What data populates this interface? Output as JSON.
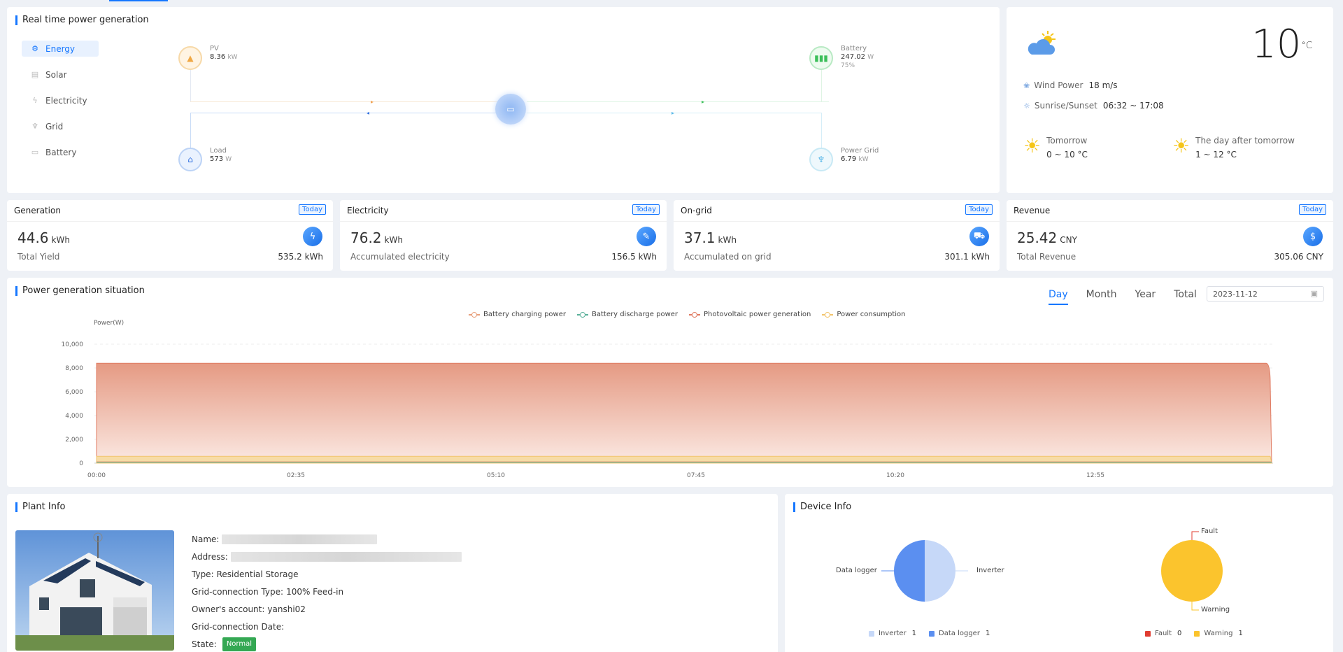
{
  "realtime": {
    "title": "Real time power generation",
    "menu": [
      {
        "label": "Energy",
        "icon": "energy-icon",
        "active": true
      },
      {
        "label": "Solar",
        "icon": "solar-icon"
      },
      {
        "label": "Electricity",
        "icon": "electricity-icon"
      },
      {
        "label": "Grid",
        "icon": "grid-icon"
      },
      {
        "label": "Battery",
        "icon": "battery-icon"
      }
    ],
    "pv": {
      "name": "PV",
      "value": "8.36",
      "unit": "kW"
    },
    "battery": {
      "name": "Battery",
      "value": "247.02",
      "unit": "W",
      "percent": "75%"
    },
    "load": {
      "name": "Load",
      "value": "573",
      "unit": "W"
    },
    "grid": {
      "name": "Power Grid",
      "value": "6.79",
      "unit": "kW"
    }
  },
  "weather": {
    "temp": "10",
    "temp_unit": "°C",
    "wind_label": "Wind Power",
    "wind_value": "18 m/s",
    "sun_label": "Sunrise/Sunset",
    "sun_value": "06:32 ~ 17:08",
    "tomorrow_label": "Tomorrow",
    "tomorrow_range": "0 ~ 10 °C",
    "after_label": "The day after tomorrow",
    "after_range": "1 ~ 12 °C"
  },
  "stats": [
    {
      "title": "Generation",
      "tag": "Today",
      "value": "44.6",
      "unit": "kWh",
      "label": "Total Yield",
      "total": "535.2 kWh",
      "icon": "lightning-icon"
    },
    {
      "title": "Electricity",
      "tag": "Today",
      "value": "76.2",
      "unit": "kWh",
      "label": "Accumulated electricity",
      "total": "156.5 kWh",
      "icon": "plug-icon"
    },
    {
      "title": "On-grid",
      "tag": "Today",
      "value": "37.1",
      "unit": "kWh",
      "label": "Accumulated on grid",
      "total": "301.1 kWh",
      "icon": "cart-icon"
    },
    {
      "title": "Revenue",
      "tag": "Today",
      "value": "25.42",
      "unit": "CNY",
      "label": "Total Revenue",
      "total": "305.06 CNY",
      "icon": "money-bag-icon"
    }
  ],
  "power_chart": {
    "title": "Power generation situation",
    "periods": [
      "Day",
      "Month",
      "Year",
      "Total"
    ],
    "active_period": "Day",
    "date": "2023-11-12"
  },
  "chart_data": {
    "type": "area",
    "ylabel": "Power(W)",
    "ylim": [
      0,
      10000
    ],
    "yticks": [
      "10,000",
      "8,000",
      "6,000",
      "4,000",
      "2,000",
      "0"
    ],
    "xticks": [
      "00:00",
      "02:35",
      "05:10",
      "07:45",
      "10:20",
      "12:55"
    ],
    "legend_position": "top-center",
    "series": [
      {
        "name": "Battery charging power",
        "color": "#e8a07c",
        "values": [
          0,
          0
        ]
      },
      {
        "name": "Battery discharge power",
        "color": "#5ab09a",
        "values": [
          0,
          0
        ]
      },
      {
        "name": "Photovoltaic power generation",
        "color": "#e07b62",
        "values": [
          8400,
          8400
        ]
      },
      {
        "name": "Power consumption",
        "color": "#f2c46c",
        "values": [
          573,
          573
        ]
      }
    ]
  },
  "plant": {
    "title": "Plant Info",
    "name_key": "Name:",
    "address_key": "Address:",
    "type_key": "Type:",
    "type_val": "Residential Storage",
    "gct_key": "Grid-connection Type:",
    "gct_val": "100% Feed-in",
    "owner_key": "Owner's account:",
    "owner_val": "yanshi02",
    "gcd_key": "Grid-connection Date:",
    "state_key": "State:",
    "state_val": "Normal"
  },
  "device": {
    "title": "Device Info",
    "pie1": [
      {
        "label": "Inverter",
        "count": "1",
        "color": "#c6d8f8"
      },
      {
        "label": "Data logger",
        "count": "1",
        "color": "#5b8ff0"
      }
    ],
    "pie2": [
      {
        "label": "Fault",
        "count": "0",
        "color": "#e03c31"
      },
      {
        "label": "Warning",
        "count": "1",
        "color": "#fbc42d"
      }
    ]
  }
}
